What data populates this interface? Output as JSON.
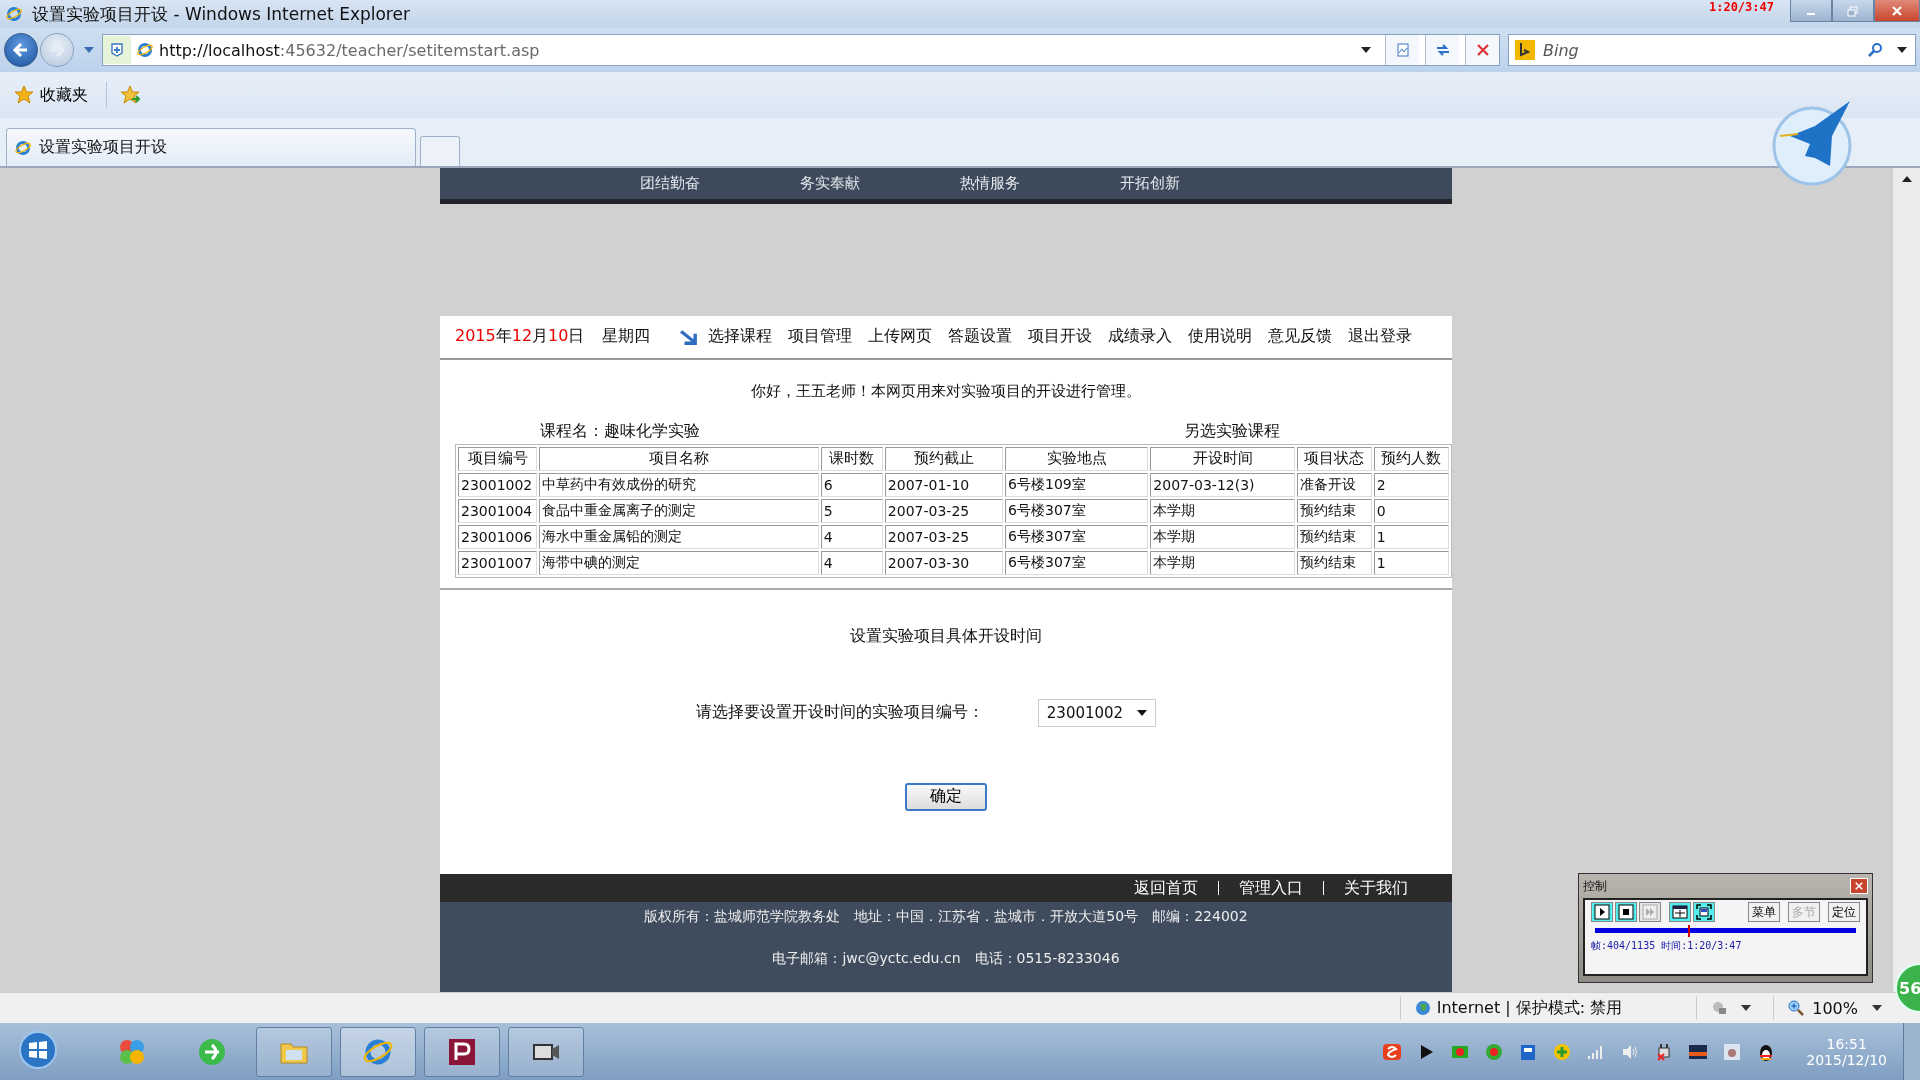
{
  "window": {
    "title": "设置实验项目开设 - Windows Internet Explorer"
  },
  "address_bar": {
    "url_host": "http://localhost",
    "url_rest": ":45632/teacher/setitemstart.asp"
  },
  "search": {
    "placeholder": "Bing"
  },
  "favorites_bar": {
    "label": "收藏夹"
  },
  "tabs": [
    {
      "label": "设置实验项目开设",
      "selected": true
    }
  ],
  "page": {
    "top_nav": [
      "团结勤奋",
      "务实奉献",
      "热情服务",
      "开拓创新"
    ],
    "date_parts": [
      {
        "text": "2015",
        "highlight": true
      },
      {
        "text": "年",
        "highlight": false
      },
      {
        "text": "12",
        "highlight": true
      },
      {
        "text": "月",
        "highlight": false
      },
      {
        "text": "10",
        "highlight": true
      },
      {
        "text": "日",
        "highlight": false
      }
    ],
    "weekday": "星期四",
    "menu": [
      "选择课程",
      "项目管理",
      "上传网页",
      "答题设置",
      "项目开设",
      "成绩录入",
      "使用说明",
      "意见反馈",
      "退出登录"
    ],
    "greeting": "你好，王五老师！本网页用来对实验项目的开设进行管理。",
    "course_label": "课程名：趣味化学实验",
    "other_course_link": "另选实验课程",
    "table": {
      "columns": [
        "项目编号",
        "项目名称",
        "课时数",
        "预约截止",
        "实验地点",
        "开设时间",
        "项目状态",
        "预约人数"
      ],
      "rows": [
        [
          "23001002",
          "中草药中有效成份的研究",
          "6",
          "2007-01-10",
          "6号楼109室",
          "2007-03-12(3)",
          "准备开设",
          "2"
        ],
        [
          "23001004",
          "食品中重金属离子的测定",
          "5",
          "2007-03-25",
          "6号楼307室",
          "本学期",
          "预约结束",
          "0"
        ],
        [
          "23001006",
          "海水中重金属铅的测定",
          "4",
          "2007-03-25",
          "6号楼307室",
          "本学期",
          "预约结束",
          "1"
        ],
        [
          "23001007",
          "海带中碘的测定",
          "4",
          "2007-03-30",
          "6号楼307室",
          "本学期",
          "预约结束",
          "1"
        ]
      ]
    },
    "section_title": "设置实验项目具体开设时间",
    "select_label": "请选择要设置开设时间的实验项目编号：",
    "select_value": "23001002",
    "confirm_button": "确定",
    "footer_links": [
      "返回首页",
      "管理入口",
      "关于我们"
    ],
    "footer_lines": [
      "版权所有：盐城师范学院教务处　地址：中国．江苏省．盐城市．开放大道50号　邮编：224002",
      "电子邮箱：jwc@yctc.edu.cn　电话：0515-8233046"
    ]
  },
  "control_panel": {
    "title": "控制",
    "buttons": [
      {
        "kind": "play",
        "disabled": false
      },
      {
        "kind": "stop",
        "disabled": false
      },
      {
        "kind": "step",
        "disabled": true
      },
      {
        "kind": "fit",
        "disabled": false
      },
      {
        "kind": "fullscreen",
        "disabled": false
      }
    ],
    "text_buttons": [
      {
        "label": "菜单",
        "disabled": false
      },
      {
        "label": "多节",
        "disabled": true
      },
      {
        "label": "定位",
        "disabled": false
      }
    ],
    "level": 0.356,
    "info": "帧:404/1135 时间:1:20/3:47"
  },
  "recorder_timer": "1:20/3:47",
  "corner_badge": "56",
  "status_bar": {
    "zone": "Internet | 保护模式: 禁用",
    "zoom": "100%"
  },
  "taskbar": {
    "time": "16:51",
    "date": "2015/12/10"
  }
}
